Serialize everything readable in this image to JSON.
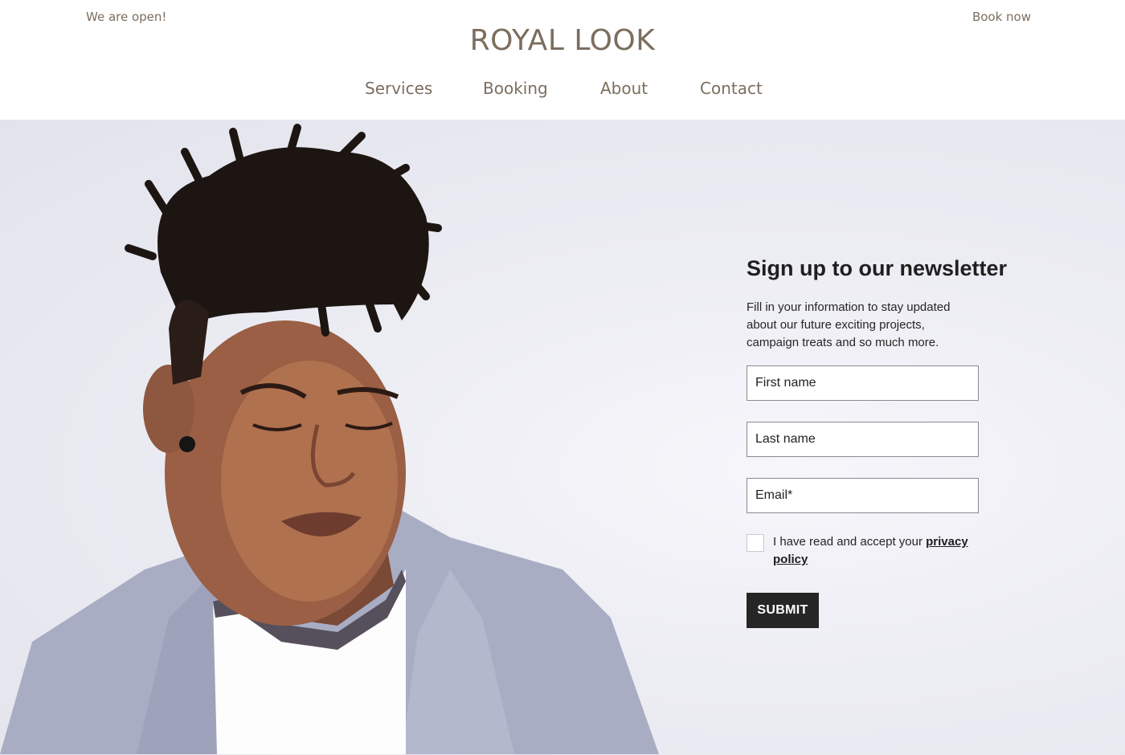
{
  "header": {
    "status_text": "We are open!",
    "brand": "ROYAL LOOK",
    "book_label": "Book now",
    "nav": [
      {
        "label": "Services"
      },
      {
        "label": "Booking"
      },
      {
        "label": "About"
      },
      {
        "label": "Contact"
      }
    ]
  },
  "hero": {
    "image_alt": "man-with-twists-portrait"
  },
  "newsletter": {
    "title": "Sign up to our newsletter",
    "description": "Fill in your information to stay updated about our future exciting projects, campaign treats and so much more.",
    "first_name_placeholder": "First name",
    "last_name_placeholder": "Last name",
    "email_placeholder": "Email*",
    "consent_prefix": "I have read and accept your ",
    "consent_link": "privacy policy",
    "submit_label": "SUBMIT"
  },
  "colors": {
    "brand": "#7b6e5e",
    "button": "#262626",
    "hero_background": "#ececf3"
  }
}
